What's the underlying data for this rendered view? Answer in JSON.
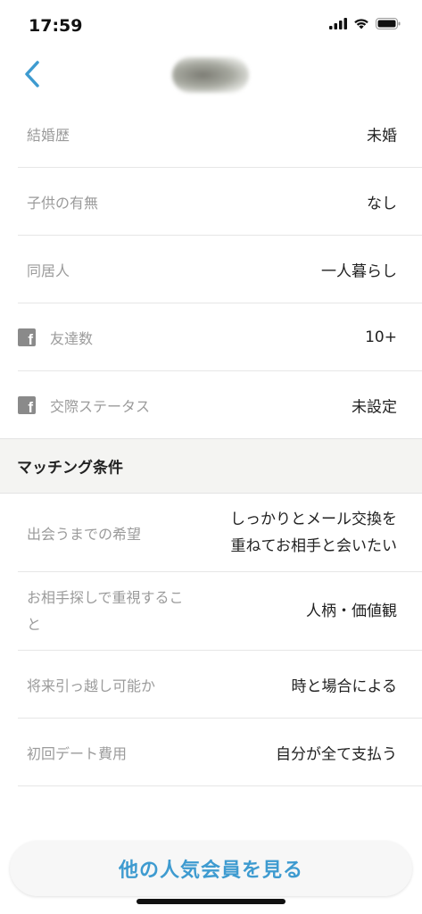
{
  "status_bar": {
    "time": "17:59",
    "icons": [
      "signal-icon",
      "wifi-icon",
      "battery-icon"
    ]
  },
  "nav": {
    "back_icon": "chevron-left-icon",
    "accent_color": "#3e9bd0"
  },
  "profile_rows": [
    {
      "label": "結婚歴",
      "value": "未婚",
      "icon": null
    },
    {
      "label": "子供の有無",
      "value": "なし",
      "icon": null
    },
    {
      "label": "同居人",
      "value": "一人暮らし",
      "icon": null
    },
    {
      "label": "友達数",
      "value": "10+",
      "icon": "facebook-icon"
    },
    {
      "label": "交際ステータス",
      "value": "未設定",
      "icon": "facebook-icon"
    }
  ],
  "matching_section": {
    "title": "マッチング条件",
    "rows": [
      {
        "label": "出会うまでの希望",
        "value_line1": "しっかりとメール交換を",
        "value_line2": "重ねてお相手と会いたい"
      },
      {
        "label_line1": "お相手探しで重視するこ",
        "label_line2": "と",
        "value": "人柄・価値観"
      },
      {
        "label": "将来引っ越し可能か",
        "value": "時と場合による"
      },
      {
        "label": "初回デート費用",
        "value": "自分が全て支払う"
      }
    ]
  },
  "bottom_button": {
    "label": "他の人気会員を見る"
  }
}
